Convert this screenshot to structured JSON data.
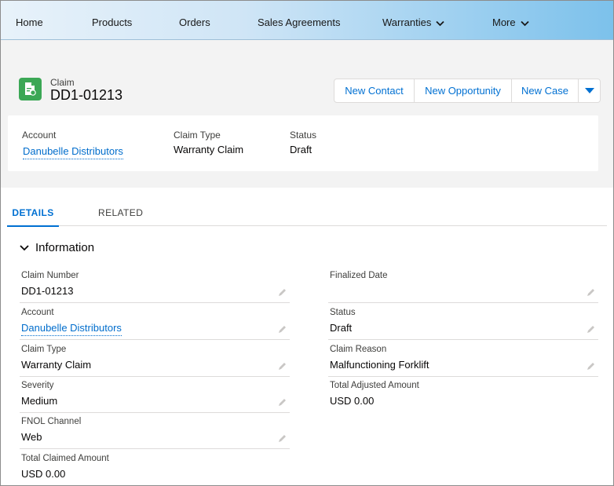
{
  "nav": {
    "items": [
      {
        "label": "Home"
      },
      {
        "label": "Products"
      },
      {
        "label": "Orders"
      },
      {
        "label": "Sales Agreements"
      },
      {
        "label": "Warranties"
      },
      {
        "label": "More"
      }
    ]
  },
  "record": {
    "object_label": "Claim",
    "title": "DD1-01213",
    "icon": "claim-document-icon",
    "icon_color": "#3ba755"
  },
  "actions": {
    "new_contact": "New Contact",
    "new_opportunity": "New Opportunity",
    "new_case": "New Case"
  },
  "highlights": {
    "account_label": "Account",
    "account_value": "Danubelle Distributors",
    "claim_type_label": "Claim Type",
    "claim_type_value": "Warranty Claim",
    "status_label": "Status",
    "status_value": "Draft"
  },
  "tabs": {
    "details": "DETAILS",
    "related": "RELATED"
  },
  "section": {
    "title": "Information"
  },
  "fields_left": [
    {
      "label": "Claim Number",
      "value": "DD1-01213"
    },
    {
      "label": "Account",
      "value": "Danubelle Distributors"
    },
    {
      "label": "Claim Type",
      "value": "Warranty Claim"
    },
    {
      "label": "Severity",
      "value": "Medium"
    },
    {
      "label": "FNOL Channel",
      "value": "Web"
    },
    {
      "label": "Total Claimed Amount",
      "value": "USD 0.00"
    }
  ],
  "fields_right": [
    {
      "label": "Finalized Date",
      "value": ""
    },
    {
      "label": "Status",
      "value": "Draft"
    },
    {
      "label": "Claim Reason",
      "value": "Malfunctioning Forklift"
    },
    {
      "label": "Total Adjusted Amount",
      "value": "USD 0.00"
    }
  ],
  "colors": {
    "link": "#006dcc",
    "brand": "#0070d2"
  }
}
